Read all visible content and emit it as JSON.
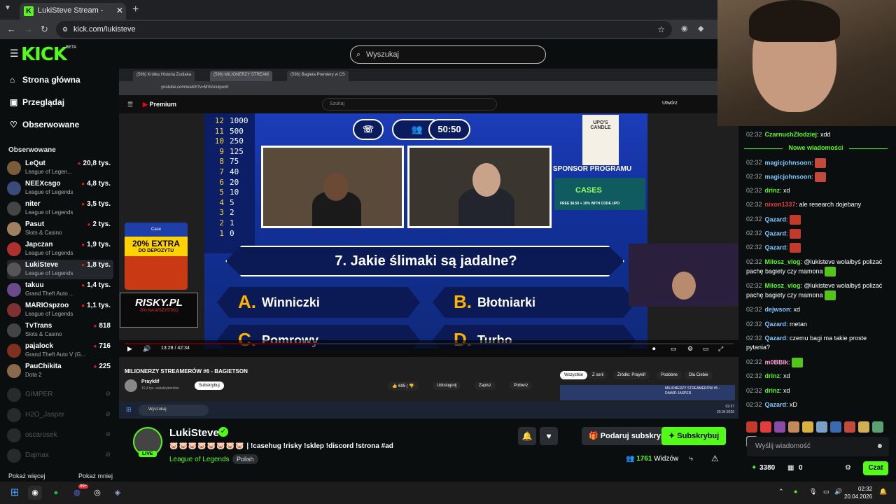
{
  "browser": {
    "tab_title": "LukiSteve Stream - Watch L",
    "url": "kick.com/lukisteve"
  },
  "kick": {
    "logo_text": "KICK",
    "logo_badge": "BETA",
    "search_placeholder": "Wyszukaj",
    "nav": [
      {
        "label": "Strona główna"
      },
      {
        "label": "Przeglądaj"
      },
      {
        "label": "Obserwowane"
      }
    ],
    "followed_heading": "Obserwowane",
    "channels": [
      {
        "name": "LeQut",
        "game": "League of Legen...",
        "viewers": "20,8 tys.",
        "color": "#7a5b3a"
      },
      {
        "name": "NEEXcsgo",
        "game": "League of Legends",
        "viewers": "4,8 tys.",
        "color": "#3a4a7a"
      },
      {
        "name": "niter",
        "game": "League of Legends",
        "viewers": "3,5 tys.",
        "color": "#444444"
      },
      {
        "name": "Pasut",
        "game": "Slots & Casino",
        "viewers": "2 tys.",
        "color": "#a08060"
      },
      {
        "name": "Japczan",
        "game": "League of Legends",
        "viewers": "1,9 tys.",
        "color": "#b03030"
      },
      {
        "name": "LukiSteve",
        "game": "League of Legends",
        "viewers": "1,8 tys.",
        "color": "#555555"
      },
      {
        "name": "takuu",
        "game": "Grand Theft Auto ...",
        "viewers": "1,4 tys.",
        "color": "#6a4a8a"
      },
      {
        "name": "MARIOspzoo",
        "game": "League of Legends",
        "viewers": "1,1 tys.",
        "color": "#803030"
      },
      {
        "name": "TvTrans",
        "game": "Slots & Casino",
        "viewers": "818",
        "color": "#444444"
      },
      {
        "name": "pajalock",
        "game": "Grand Theft Auto V (G...",
        "viewers": "716",
        "color": "#803020"
      },
      {
        "name": "PauChikita",
        "game": "Dota 2",
        "viewers": "225",
        "color": "#8a6a4a"
      }
    ],
    "offline": [
      {
        "name": "GIMPER"
      },
      {
        "name": "H2O_Jasper"
      },
      {
        "name": "oscarosek"
      },
      {
        "name": "Dajmax"
      }
    ],
    "show_more": "Pokaż więcej",
    "show_less": "Pokaż mniej"
  },
  "video": {
    "inner_tabs": [
      "(596) Krótka Historia Zodiaka",
      "(596) MILIONERZY STREAM",
      "(596) Bagieta Premiery w CS"
    ],
    "inner_url": "youtube.com/watch?v=MViAculpuv0",
    "inner_search": "Szukaj",
    "yt_logo": "Premium",
    "create_label": "Utwórz",
    "ladder": [
      {
        "n": "12",
        "v": "1000"
      },
      {
        "n": "11",
        "v": "500"
      },
      {
        "n": "10",
        "v": "250"
      },
      {
        "n": "9",
        "v": "125"
      },
      {
        "n": "8",
        "v": "75"
      },
      {
        "n": "7",
        "v": "40"
      },
      {
        "n": "6",
        "v": "20"
      },
      {
        "n": "5",
        "v": "10"
      },
      {
        "n": "4",
        "v": "5"
      },
      {
        "n": "3",
        "v": "2"
      },
      {
        "n": "2",
        "v": "1"
      },
      {
        "n": "1",
        "v": "0"
      }
    ],
    "lifeline_5050": "50:50",
    "sponsor_logo": "UPO'S CANDLE",
    "sponsor_label": "SPONSOR PROGRAMU",
    "sponsor_banner": "CASES",
    "sponsor_small": "FREE $0.50 + 10% WITH CODE UPO",
    "question": "7. Jakie ślimaki są jadalne?",
    "answers": [
      {
        "letter": "A.",
        "text": "Winniczki"
      },
      {
        "letter": "B.",
        "text": "Błotniarki"
      },
      {
        "letter": "C.",
        "text": "Pomrowy"
      },
      {
        "letter": "D.",
        "text": "Turbo"
      }
    ],
    "ad1_top": "Case",
    "ad1_main": "20% EXTRA",
    "ad1_sub": "DO DEPOZYTU",
    "ad2_main": "RISKY.PL",
    "ad2_sub": "-5% NA WSZYSTKO",
    "time": "13:28 / 42:34",
    "progress": 0.316,
    "title": "MILIONERZY STREAMERÓW #6 - BAGIETSON",
    "channel": "Praykłif",
    "subs_line": "10,4 tys. subskrybentów",
    "subscribe": "Subskrybuj",
    "likes": "695",
    "share": "Udostępnij",
    "save": "Zapisz",
    "download": "Pobierz",
    "chips": [
      "Wszystkie",
      "Z serii",
      "Źródło: Praykłif",
      "Podobne",
      "Dla Ciebie"
    ],
    "next_title": "MILIONERZY STREAMERÓW #5 - DAWID JASPER",
    "taskbar_search": "Wyszukaj",
    "inner_clock_time": "02:37",
    "inner_clock_date": "20.04.2026"
  },
  "stream": {
    "name": "LukiSteve",
    "live": "LIVE",
    "emotes": "🐷🐷🐷🐷🐷🐷🐷🐷",
    "title": "| !casehug !risky !sklep !discord !strona #ad",
    "category": "League of Legends",
    "tag": "Polish",
    "gift": "Podaruj subskrypcje",
    "subscribe": "Subskrybuj",
    "viewers_count": "1761",
    "viewers_label": "Widzów"
  },
  "chat": {
    "first": {
      "time": "02:32",
      "user": "CzarnuchZlodziej",
      "text": ": xdd",
      "color": "#53fc18"
    },
    "new_messages": "Nowe wiadomości",
    "messages": [
      {
        "time": "02:32",
        "user": "magicjohnsoon",
        "text": ":",
        "color": "#7ec8ff",
        "emote": "#c24a3a"
      },
      {
        "time": "02:32",
        "user": "magicjohnsoon",
        "text": ":",
        "color": "#7ec8ff",
        "emote": "#c24a3a"
      },
      {
        "time": "02:32",
        "user": "drinz",
        "text": ": xd",
        "color": "#53fc18"
      },
      {
        "time": "02:32",
        "user": "nixon1337",
        "text": ": ale research dojebany",
        "color": "#e23d3d"
      },
      {
        "time": "02:32",
        "user": "Qazard",
        "text": ":",
        "color": "#7ec8ff",
        "emote": "#c23a2a"
      },
      {
        "time": "02:32",
        "user": "Qazard",
        "text": ":",
        "color": "#7ec8ff",
        "emote": "#c23a2a"
      },
      {
        "time": "02:32",
        "user": "Qazard",
        "text": ":",
        "color": "#7ec8ff",
        "emote": "#c23a2a"
      },
      {
        "time": "02:32",
        "user": "Milosz_vlog",
        "text": ": @lukisteve wolałbyś polizać pachę bagiety czy mamona",
        "color": "#53fc18",
        "emote": "#53c418"
      },
      {
        "time": "02:32",
        "user": "Milosz_vlog",
        "text": ": @lukisteve wolałbyś polizać pachę bagiety czy mamona",
        "color": "#53fc18",
        "emote": "#53c418"
      },
      {
        "time": "02:32",
        "user": "dejwson",
        "text": ": xd",
        "color": "#7ec8ff"
      },
      {
        "time": "02:32",
        "user": "Qazard",
        "text": ": metan",
        "color": "#7ec8ff"
      },
      {
        "time": "02:32",
        "user": "Qazard",
        "text": ": czemu bagi ma takie proste pytania?",
        "color": "#7ec8ff"
      },
      {
        "time": "02:32",
        "user": "m0BBik",
        "text": ":",
        "color": "#ff9bd2",
        "emote": "#53c418"
      },
      {
        "time": "02:32",
        "user": "drinz",
        "text": ": xd",
        "color": "#53fc18"
      },
      {
        "time": "02:32",
        "user": "drinz",
        "text": ": xd",
        "color": "#53fc18"
      },
      {
        "time": "02:32",
        "user": "Qazard",
        "text": ": xD",
        "color": "#7ec8ff"
      }
    ],
    "input_placeholder": "Wyślij wiadomość",
    "points": "3380",
    "second_count": "0",
    "chat_button": "Czat"
  },
  "taskbar": {
    "time": "02:32",
    "date": "20.04.2026",
    "badge": "99+"
  }
}
